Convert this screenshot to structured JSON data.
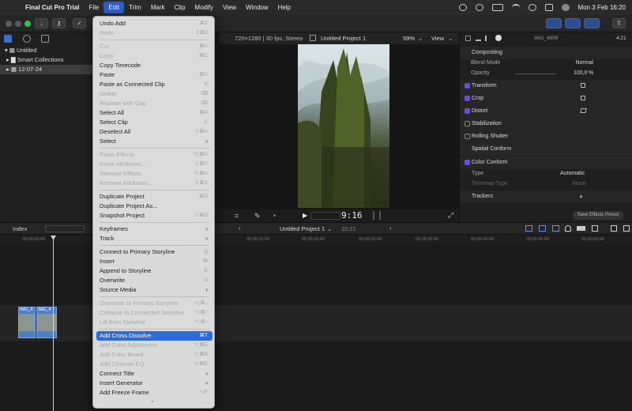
{
  "menubar": {
    "app": "Final Cut Pro Trial",
    "items": [
      "File",
      "Edit",
      "Trim",
      "Mark",
      "Clip",
      "Modify",
      "View",
      "Window",
      "Help"
    ],
    "clock": "Mon 3 Feb  16:20"
  },
  "browser": {
    "items": [
      {
        "label": "Untitled",
        "icon": "library-icon"
      },
      {
        "label": "Smart Collections",
        "icon": "folder-icon"
      },
      {
        "label": "12-07-24",
        "icon": "event-icon"
      }
    ]
  },
  "viewer": {
    "format": "720×1280 | 30 fps, Stereo",
    "project": "Untitled Project 1",
    "zoom": "59%",
    "view": "View",
    "timecode": "9:16"
  },
  "inspector": {
    "clip_name": "IMG_4609",
    "duration": "4:21",
    "compositing": "Compositing",
    "blend_mode_label": "Blend Mode",
    "blend_mode_value": "Normal",
    "opacity_label": "Opacity",
    "opacity_value": "100,0",
    "opacity_unit": "%",
    "transform": "Transform",
    "crop": "Crop",
    "distort": "Distort",
    "stabilization": "Stabilization",
    "rolling_shutter": "Rolling Shutter",
    "spatial_conform": "Spatial Conform",
    "color_conform": "Color Conform",
    "type_label": "Type",
    "type_value": "Automatic",
    "tonemap_label": "Tonemap Type",
    "tonemap_value": "None",
    "trackers": "Trackers",
    "save_preset": "Save Effects Preset"
  },
  "timeline": {
    "index": "Index",
    "project": "Untitled Project 1",
    "duration": "10:21",
    "ruler": [
      "00:00:00:00",
      "00:00:05:00",
      "00:00:10:00",
      "00:00:15:00",
      "00:00:20:00",
      "00:00:25:00",
      "00:00:30:00",
      "00:00:35:00",
      "00:00:40:00",
      "00:00:45:00",
      "00:00:50:00"
    ],
    "clips": [
      "IMG_4",
      "IMG_4"
    ]
  },
  "edit_menu": {
    "items": [
      {
        "label": "Undo Add",
        "shortcut": "⌘Z",
        "enabled": true
      },
      {
        "label": "Redo",
        "shortcut": "⇧⌘Z",
        "enabled": false
      },
      {
        "sep": true
      },
      {
        "label": "Cut",
        "shortcut": "⌘X",
        "enabled": false
      },
      {
        "label": "Copy",
        "shortcut": "⌘C",
        "enabled": false
      },
      {
        "label": "Copy Timecode",
        "shortcut": "",
        "enabled": true
      },
      {
        "label": "Paste",
        "shortcut": "⌘V",
        "enabled": true
      },
      {
        "label": "Paste as Connected Clip",
        "shortcut": "V",
        "enabled": true
      },
      {
        "label": "Delete",
        "shortcut": "⌫",
        "enabled": false
      },
      {
        "label": "Replace with Gap",
        "shortcut": "⌫",
        "enabled": false
      },
      {
        "label": "Select All",
        "shortcut": "⌘A",
        "enabled": true
      },
      {
        "label": "Select Clip",
        "shortcut": "C",
        "enabled": true
      },
      {
        "label": "Deselect All",
        "shortcut": "⇧⌘A",
        "enabled": true
      },
      {
        "label": "Select",
        "submenu": true,
        "enabled": true
      },
      {
        "sep": true
      },
      {
        "label": "Paste Effects",
        "shortcut": "⌥⌘V",
        "enabled": false
      },
      {
        "label": "Paste Attributes...",
        "shortcut": "⇧⌘V",
        "enabled": false
      },
      {
        "label": "Remove Effects",
        "shortcut": "⌥⌘X",
        "enabled": false
      },
      {
        "label": "Remove Attributes...",
        "shortcut": "⇧⌘X",
        "enabled": false
      },
      {
        "sep": true
      },
      {
        "label": "Duplicate Project",
        "shortcut": "⌘D",
        "enabled": true
      },
      {
        "label": "Duplicate Project As...",
        "shortcut": "",
        "enabled": true
      },
      {
        "label": "Snapshot Project",
        "shortcut": "⇧⌘D",
        "enabled": true
      },
      {
        "sep": true
      },
      {
        "label": "Keyframes",
        "submenu": true,
        "enabled": true
      },
      {
        "label": "Track",
        "submenu": true,
        "enabled": true
      },
      {
        "sep": true
      },
      {
        "label": "Connect to Primary Storyline",
        "shortcut": "Q",
        "enabled": true
      },
      {
        "label": "Insert",
        "shortcut": "W",
        "enabled": true
      },
      {
        "label": "Append to Storyline",
        "shortcut": "E",
        "enabled": true
      },
      {
        "label": "Overwrite",
        "shortcut": "D",
        "enabled": true
      },
      {
        "label": "Source Media",
        "submenu": true,
        "enabled": true
      },
      {
        "sep": true
      },
      {
        "label": "Overwrite to Primary Storyline",
        "shortcut": "⌥⌘↓",
        "enabled": false
      },
      {
        "label": "Collapse to Connected Storyline",
        "shortcut": "⌥⌘↑",
        "enabled": false
      },
      {
        "label": "Lift from Storyline",
        "shortcut": "⌥⌘↑",
        "enabled": false
      },
      {
        "sep": true
      },
      {
        "label": "Add Cross Dissolve",
        "shortcut": "⌘T",
        "enabled": true,
        "highlighted": true
      },
      {
        "label": "Add Color Adjustment",
        "shortcut": "⌥⌘E",
        "enabled": false
      },
      {
        "label": "Add Color Board",
        "shortcut": "⌥⌘B",
        "enabled": false
      },
      {
        "label": "Add Channel EQ",
        "shortcut": "⌥⌘E",
        "enabled": false
      },
      {
        "label": "Connect Title",
        "submenu": true,
        "enabled": true
      },
      {
        "label": "Insert Generator",
        "submenu": true,
        "enabled": true
      },
      {
        "label": "Add Freeze Frame",
        "shortcut": "⌥F",
        "enabled": true
      }
    ]
  },
  "colors": {
    "accent": "#2f6bd8",
    "inspector_check": "#6a4fd6",
    "clip": "#4d7fc4"
  }
}
